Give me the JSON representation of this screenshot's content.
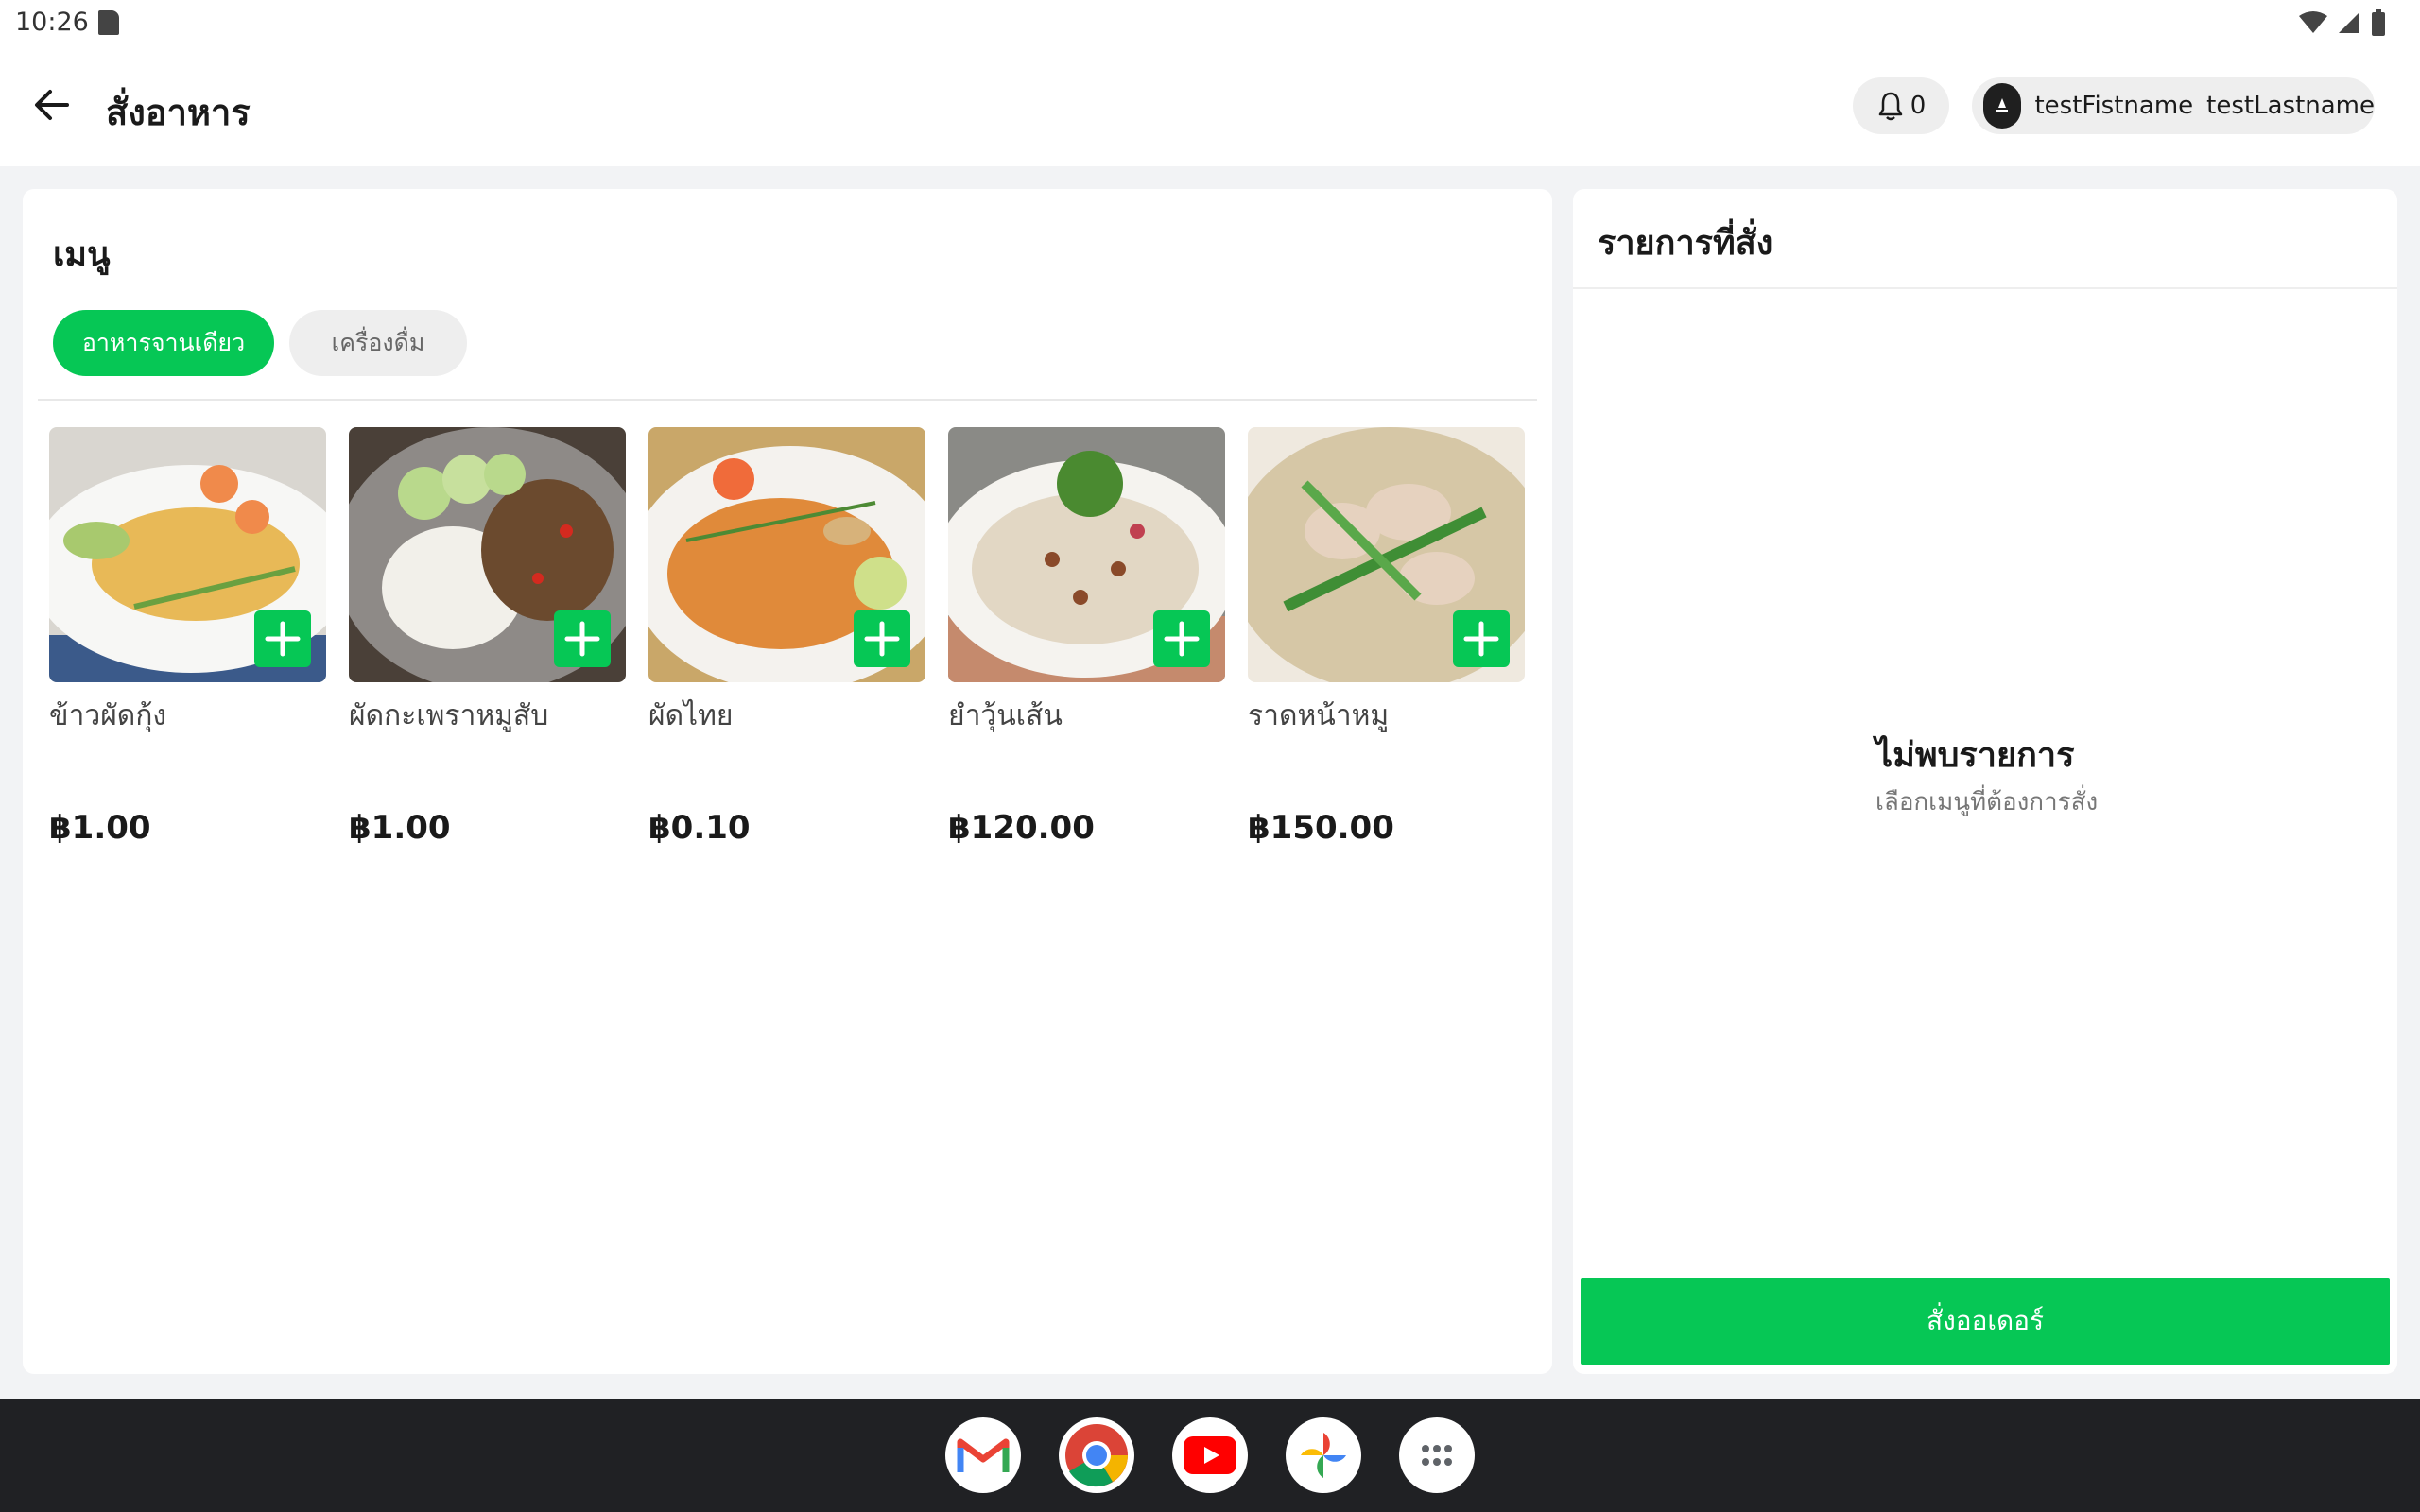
{
  "status_bar": {
    "time": "10:26"
  },
  "app_bar": {
    "title": "สั่งอาหาร",
    "notification_count": "0",
    "user_first": "testFistname",
    "user_last": "testLastname"
  },
  "menu": {
    "title": "เมนู",
    "categories": [
      {
        "label": "อาหารจานเดียว",
        "active": true
      },
      {
        "label": "เครื่องดื่ม",
        "active": false
      }
    ],
    "items": [
      {
        "name": "ข้าวผัดกุ้ง",
        "price": "฿1.00",
        "image": "fried-rice-shrimp"
      },
      {
        "name": "ผัดกะเพราหมูสับ",
        "price": "฿1.00",
        "image": "basil-pork-rice"
      },
      {
        "name": "ผัดไทย",
        "price": "฿0.10",
        "image": "pad-thai"
      },
      {
        "name": "ยำวุ้นเส้น",
        "price": "฿120.00",
        "image": "glass-noodle-salad"
      },
      {
        "name": "ราดหน้าหมู",
        "price": "฿150.00",
        "image": "rad-na-pork"
      }
    ]
  },
  "order": {
    "title": "รายการที่สั่ง",
    "empty_title": "ไม่พบรายการ",
    "empty_subtitle": "เลือกเมนูที่ต้องการสั่ง",
    "submit_label": "สั่งออเดอร์"
  },
  "dock": [
    "gmail-icon",
    "chrome-icon",
    "youtube-icon",
    "photos-icon",
    "apps-icon"
  ],
  "colors": {
    "accent": "#06c755",
    "background": "#f2f3f5",
    "taskbar": "#202124"
  }
}
